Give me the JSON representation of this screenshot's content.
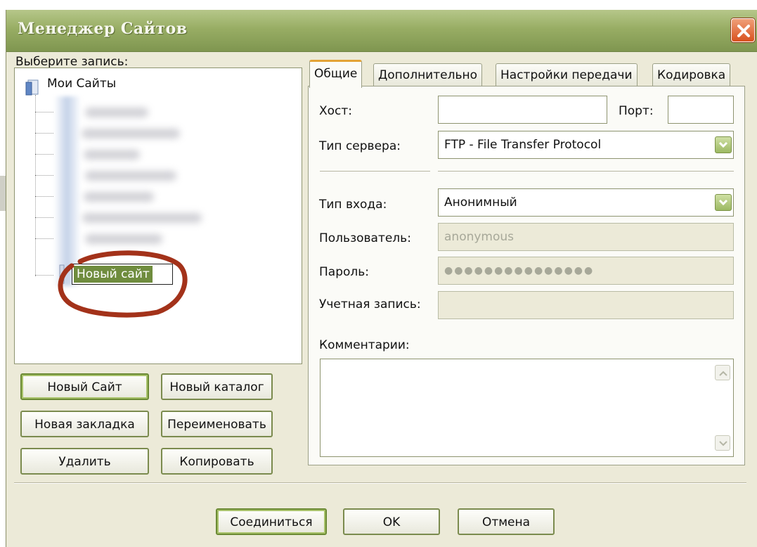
{
  "window": {
    "title": "Менеджер Сайтов",
    "close_icon": "close-icon"
  },
  "left": {
    "select_label": "Выберите запись:",
    "tree": {
      "root_label": "Мои Сайты",
      "new_site_label": "Новый сайт"
    },
    "buttons": {
      "new_site": "Новый Сайт",
      "new_folder": "Новый каталог",
      "new_bookmark": "Новая закладка",
      "rename": "Переименовать",
      "delete": "Удалить",
      "copy": "Копировать"
    }
  },
  "tabs": [
    "Общие",
    "Дополнительно",
    "Настройки передачи",
    "Кодировка"
  ],
  "general": {
    "host_label": "Хост:",
    "host_value": "",
    "port_label": "Порт:",
    "port_value": "",
    "server_type_label": "Тип сервера:",
    "server_type_value": "FTP - File Transfer Protocol",
    "logon_type_label": "Тип входа:",
    "logon_type_value": "Анонимный",
    "user_label": "Пользователь:",
    "user_value": "anonymous",
    "password_label": "Пароль:",
    "password_value": "●●●●●●●●●●●●●●●",
    "account_label": "Учетная запись:",
    "account_value": "",
    "comments_label": "Комментарии:",
    "comments_value": ""
  },
  "footer": {
    "connect": "Соединиться",
    "ok": "OK",
    "cancel": "Отмена"
  },
  "colors": {
    "titlebar": "#98ad64",
    "window_bg": "#ecead8",
    "active_tab_accent": "#e3a336",
    "selection": "#6f8c3e",
    "annotation": "#a3321a"
  }
}
